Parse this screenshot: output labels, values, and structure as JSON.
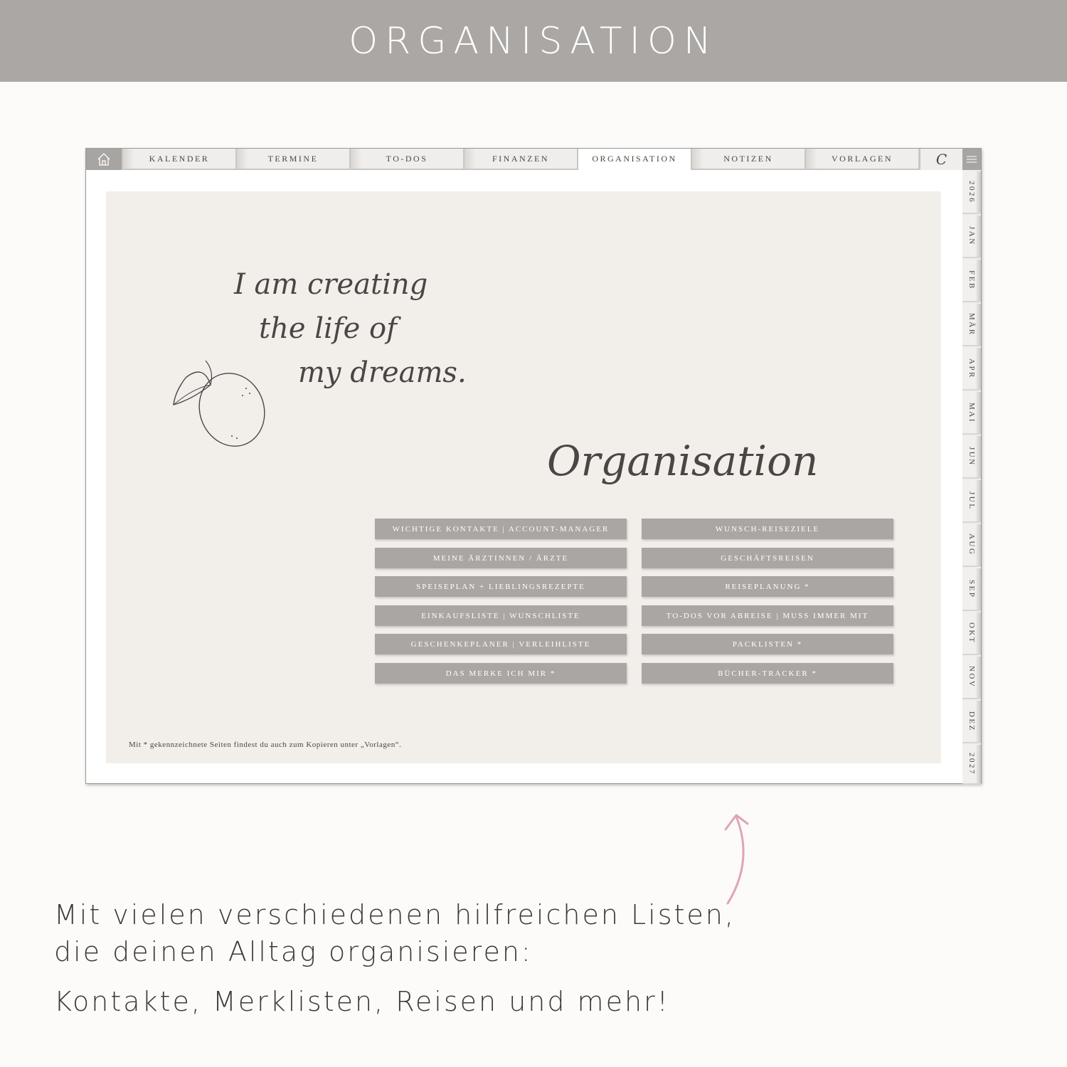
{
  "banner": {
    "title": "ORGANISATION"
  },
  "planner": {
    "tabs": [
      "KALENDER",
      "TERMINE",
      "TO-DOS",
      "FINANZEN",
      "ORGANISATION",
      "NOTIZEN",
      "VORLAGEN"
    ],
    "active_tab": "ORGANISATION",
    "logo_letter": "C",
    "side_tabs": [
      "2026",
      "JAN",
      "FEB",
      "MÄR",
      "APR",
      "MAI",
      "JUN",
      "JUL",
      "AUG",
      "SEP",
      "OKT",
      "NOV",
      "DEZ",
      "2027"
    ],
    "quote": {
      "line1": "I am creating",
      "line2": "the life of",
      "line3": "my dreams."
    },
    "section_title": "Organisation",
    "buttons_left": [
      "WICHTIGE KONTAKTE  |  ACCOUNT-MANAGER",
      "MEINE ÄRZTINNEN / ÄRZTE",
      "SPEISEPLAN + LIEBLINGSREZEPTE",
      "EINKAUFSLISTE  |  WUNSCHLISTE",
      "GESCHENKEPLANER  |  VERLEIHLISTE",
      "DAS MERKE ICH MIR *"
    ],
    "buttons_right": [
      "WUNSCH-REISEZIELE",
      "GESCHÄFTSREISEN",
      "REISEPLANUNG *",
      "TO-DOS VOR ABREISE  |  MUSS IMMER MIT",
      "PACKLISTEN *",
      "BÜCHER-TRACKER *"
    ],
    "footnote": "Mit * gekennzeichnete Seiten findest du auch zum Kopieren unter „Vorlagen“."
  },
  "caption": {
    "line1": "Mit vielen verschiedenen hilfreichen Listen,",
    "line2": "die deinen Alltag organisieren:",
    "line3": "Kontakte, Merklisten, Reisen und mehr!"
  },
  "colors": {
    "banner": "#aba7a4",
    "button": "#a9a6a3",
    "arrow": "#e0a3b8",
    "page_bg": "#f2efeb"
  },
  "icons": {
    "home": "home-icon",
    "menu": "hamburger-menu-icon",
    "arrow": "curved-arrow-icon",
    "lemon": "lemon-illustration"
  }
}
